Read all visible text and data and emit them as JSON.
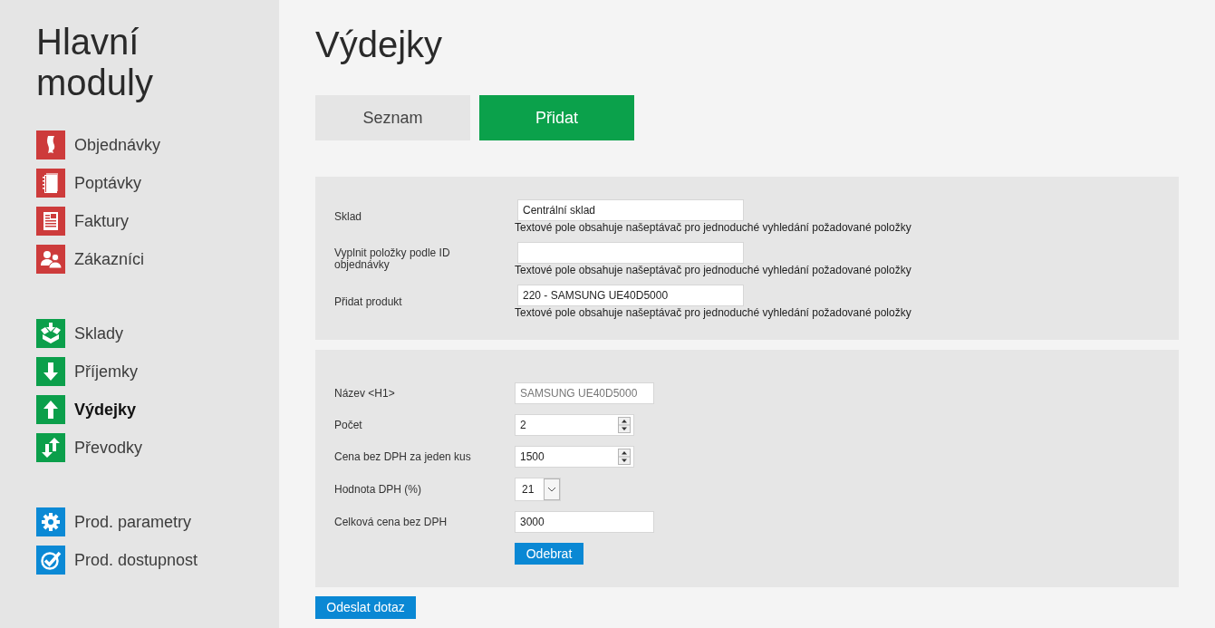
{
  "sidebar": {
    "title": "Hlavní moduly",
    "groups": [
      {
        "color": "#cd3b3b",
        "items": [
          {
            "label": "Objednávky",
            "selected": false
          },
          {
            "label": "Poptávky",
            "selected": false
          },
          {
            "label": "Faktury",
            "selected": false
          },
          {
            "label": "Zákazníci",
            "selected": false
          }
        ]
      },
      {
        "color": "#0b9f4b",
        "items": [
          {
            "label": "Sklady",
            "selected": false
          },
          {
            "label": "Příjemky",
            "selected": false
          },
          {
            "label": "Výdejky",
            "selected": true
          },
          {
            "label": "Převodky",
            "selected": false
          }
        ]
      },
      {
        "color": "#0b89d5",
        "items": [
          {
            "label": "Prod. parametry",
            "selected": false
          },
          {
            "label": "Prod. dostupnost",
            "selected": false
          }
        ]
      }
    ]
  },
  "page_title": "Výdejky",
  "tabs": [
    {
      "label": "Seznam",
      "selected": false
    },
    {
      "label": "Přidat",
      "selected": true
    }
  ],
  "search_panel": {
    "fields": [
      {
        "label": "Sklad",
        "value": "Centrální sklad",
        "hint": "Textové pole obsahuje našeptávač pro jednoduché vyhledání požadované položky"
      },
      {
        "label": "Vyplnit položky podle ID objednávky",
        "hint": "Textové pole obsahuje našeptávač pro jednoduché vyhledání požadované položky"
      },
      {
        "label": "Přidat produkt",
        "value": "220 - SAMSUNG UE40D5000",
        "hint": "Textové pole obsahuje našeptávač pro jednoduché vyhledání požadované položky"
      }
    ]
  },
  "item_panel": {
    "fields": [
      {
        "kind": "text",
        "label": "Název <H1>",
        "value": "SAMSUNG UE40D5000",
        "disabled": true
      },
      {
        "kind": "number",
        "label": "Počet",
        "value": "2",
        "disabled": false
      },
      {
        "kind": "number",
        "label": "Cena bez DPH za jeden kus",
        "value": "1500",
        "disabled": false
      },
      {
        "kind": "select",
        "label": "Hodnota DPH (%)",
        "value": "21",
        "disabled": false
      },
      {
        "kind": "text",
        "label": "Celková cena bez DPH",
        "value": "3000",
        "disabled": false
      }
    ],
    "remove_button": "Odebrat"
  },
  "submit_button": "Odeslat dotaz"
}
